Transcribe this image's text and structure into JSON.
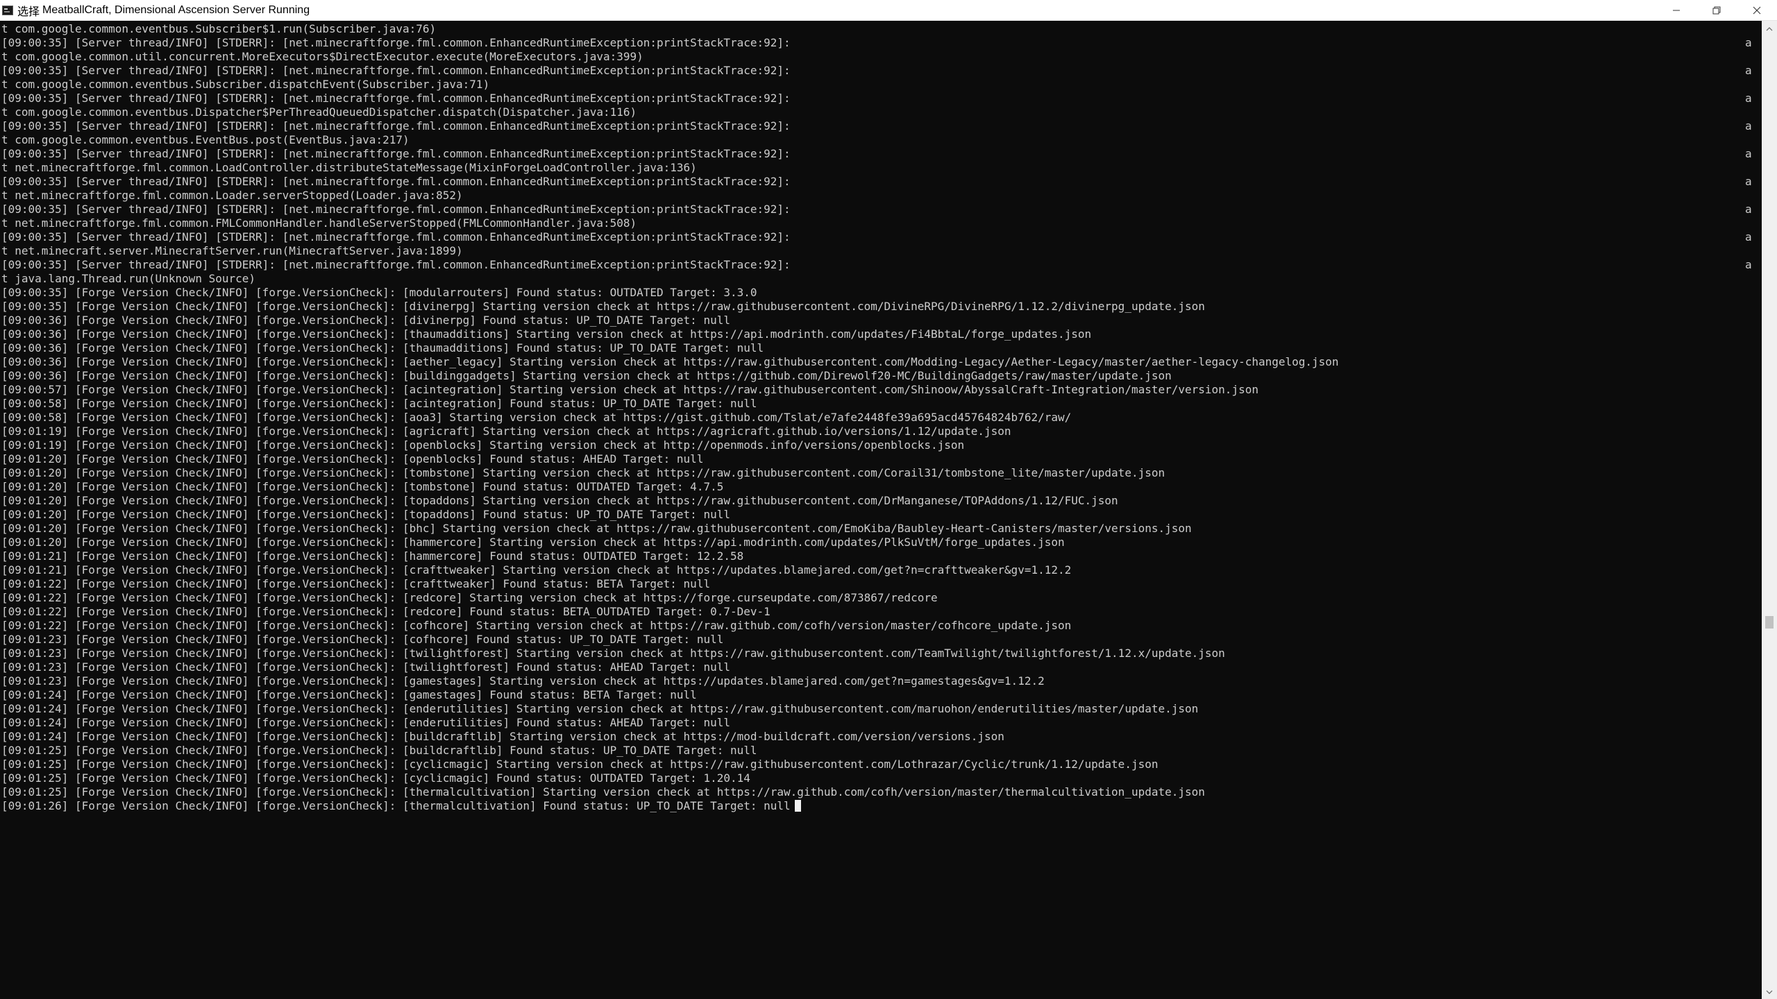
{
  "window": {
    "title_prefix": "选择",
    "title": "MeatballCraft, Dimensional Ascension Server Running"
  },
  "controls": {
    "minimize": "minimize-icon",
    "maximize": "restore-icon",
    "close": "close-icon"
  },
  "console": {
    "lines": [
      "t com.google.common.eventbus.Subscriber$1.run(Subscriber.java:76)",
      "[09:00:35] [Server thread/INFO] [STDERR]: [net.minecraftforge.fml.common.EnhancedRuntimeException:printStackTrace:92]:",
      "t com.google.common.util.concurrent.MoreExecutors$DirectExecutor.execute(MoreExecutors.java:399)",
      "[09:00:35] [Server thread/INFO] [STDERR]: [net.minecraftforge.fml.common.EnhancedRuntimeException:printStackTrace:92]:",
      "t com.google.common.eventbus.Subscriber.dispatchEvent(Subscriber.java:71)",
      "[09:00:35] [Server thread/INFO] [STDERR]: [net.minecraftforge.fml.common.EnhancedRuntimeException:printStackTrace:92]:",
      "t com.google.common.eventbus.Dispatcher$PerThreadQueuedDispatcher.dispatch(Dispatcher.java:116)",
      "[09:00:35] [Server thread/INFO] [STDERR]: [net.minecraftforge.fml.common.EnhancedRuntimeException:printStackTrace:92]:",
      "t com.google.common.eventbus.EventBus.post(EventBus.java:217)",
      "[09:00:35] [Server thread/INFO] [STDERR]: [net.minecraftforge.fml.common.EnhancedRuntimeException:printStackTrace:92]:",
      "t net.minecraftforge.fml.common.LoadController.distributeStateMessage(MixinForgeLoadController.java:136)",
      "[09:00:35] [Server thread/INFO] [STDERR]: [net.minecraftforge.fml.common.EnhancedRuntimeException:printStackTrace:92]:",
      "t net.minecraftforge.fml.common.Loader.serverStopped(Loader.java:852)",
      "[09:00:35] [Server thread/INFO] [STDERR]: [net.minecraftforge.fml.common.EnhancedRuntimeException:printStackTrace:92]:",
      "t net.minecraftforge.fml.common.FMLCommonHandler.handleServerStopped(FMLCommonHandler.java:508)",
      "[09:00:35] [Server thread/INFO] [STDERR]: [net.minecraftforge.fml.common.EnhancedRuntimeException:printStackTrace:92]:",
      "t net.minecraft.server.MinecraftServer.run(MinecraftServer.java:1899)",
      "[09:00:35] [Server thread/INFO] [STDERR]: [net.minecraftforge.fml.common.EnhancedRuntimeException:printStackTrace:92]:",
      "t java.lang.Thread.run(Unknown Source)",
      "[09:00:35] [Forge Version Check/INFO] [forge.VersionCheck]: [modularrouters] Found status: OUTDATED Target: 3.3.0",
      "[09:00:35] [Forge Version Check/INFO] [forge.VersionCheck]: [divinerpg] Starting version check at https://raw.githubusercontent.com/DivineRPG/DivineRPG/1.12.2/divinerpg_update.json",
      "[09:00:36] [Forge Version Check/INFO] [forge.VersionCheck]: [divinerpg] Found status: UP_TO_DATE Target: null",
      "[09:00:36] [Forge Version Check/INFO] [forge.VersionCheck]: [thaumadditions] Starting version check at https://api.modrinth.com/updates/Fi4BbtaL/forge_updates.json",
      "[09:00:36] [Forge Version Check/INFO] [forge.VersionCheck]: [thaumadditions] Found status: UP_TO_DATE Target: null",
      "[09:00:36] [Forge Version Check/INFO] [forge.VersionCheck]: [aether_legacy] Starting version check at https://raw.githubusercontent.com/Modding-Legacy/Aether-Legacy/master/aether-legacy-changelog.json",
      "[09:00:36] [Forge Version Check/INFO] [forge.VersionCheck]: [buildinggadgets] Starting version check at https://github.com/Direwolf20-MC/BuildingGadgets/raw/master/update.json",
      "[09:00:57] [Forge Version Check/INFO] [forge.VersionCheck]: [acintegration] Starting version check at https://raw.githubusercontent.com/Shinoow/AbyssalCraft-Integration/master/version.json",
      "[09:00:58] [Forge Version Check/INFO] [forge.VersionCheck]: [acintegration] Found status: UP_TO_DATE Target: null",
      "[09:00:58] [Forge Version Check/INFO] [forge.VersionCheck]: [aoa3] Starting version check at https://gist.github.com/Tslat/e7afe2448fe39a695acd45764824b762/raw/",
      "[09:01:19] [Forge Version Check/INFO] [forge.VersionCheck]: [agricraft] Starting version check at https://agricraft.github.io/versions/1.12/update.json",
      "[09:01:19] [Forge Version Check/INFO] [forge.VersionCheck]: [openblocks] Starting version check at http://openmods.info/versions/openblocks.json",
      "[09:01:20] [Forge Version Check/INFO] [forge.VersionCheck]: [openblocks] Found status: AHEAD Target: null",
      "[09:01:20] [Forge Version Check/INFO] [forge.VersionCheck]: [tombstone] Starting version check at https://raw.githubusercontent.com/Corail31/tombstone_lite/master/update.json",
      "[09:01:20] [Forge Version Check/INFO] [forge.VersionCheck]: [tombstone] Found status: OUTDATED Target: 4.7.5",
      "[09:01:20] [Forge Version Check/INFO] [forge.VersionCheck]: [topaddons] Starting version check at https://raw.githubusercontent.com/DrManganese/TOPAddons/1.12/FUC.json",
      "[09:01:20] [Forge Version Check/INFO] [forge.VersionCheck]: [topaddons] Found status: UP_TO_DATE Target: null",
      "[09:01:20] [Forge Version Check/INFO] [forge.VersionCheck]: [bhc] Starting version check at https://raw.githubusercontent.com/EmoKiba/Baubley-Heart-Canisters/master/versions.json",
      "[09:01:20] [Forge Version Check/INFO] [forge.VersionCheck]: [hammercore] Starting version check at https://api.modrinth.com/updates/PlkSuVtM/forge_updates.json",
      "[09:01:21] [Forge Version Check/INFO] [forge.VersionCheck]: [hammercore] Found status: OUTDATED Target: 12.2.58",
      "[09:01:21] [Forge Version Check/INFO] [forge.VersionCheck]: [crafttweaker] Starting version check at https://updates.blamejared.com/get?n=crafttweaker&gv=1.12.2",
      "[09:01:22] [Forge Version Check/INFO] [forge.VersionCheck]: [crafttweaker] Found status: BETA Target: null",
      "[09:01:22] [Forge Version Check/INFO] [forge.VersionCheck]: [redcore] Starting version check at https://forge.curseupdate.com/873867/redcore",
      "[09:01:22] [Forge Version Check/INFO] [forge.VersionCheck]: [redcore] Found status: BETA_OUTDATED Target: 0.7-Dev-1",
      "[09:01:22] [Forge Version Check/INFO] [forge.VersionCheck]: [cofhcore] Starting version check at https://raw.github.com/cofh/version/master/cofhcore_update.json",
      "[09:01:23] [Forge Version Check/INFO] [forge.VersionCheck]: [cofhcore] Found status: UP_TO_DATE Target: null",
      "[09:01:23] [Forge Version Check/INFO] [forge.VersionCheck]: [twilightforest] Starting version check at https://raw.githubusercontent.com/TeamTwilight/twilightforest/1.12.x/update.json",
      "[09:01:23] [Forge Version Check/INFO] [forge.VersionCheck]: [twilightforest] Found status: AHEAD Target: null",
      "[09:01:23] [Forge Version Check/INFO] [forge.VersionCheck]: [gamestages] Starting version check at https://updates.blamejared.com/get?n=gamestages&gv=1.12.2",
      "[09:01:24] [Forge Version Check/INFO] [forge.VersionCheck]: [gamestages] Found status: BETA Target: null",
      "[09:01:24] [Forge Version Check/INFO] [forge.VersionCheck]: [enderutilities] Starting version check at https://raw.githubusercontent.com/maruohon/enderutilities/master/update.json",
      "[09:01:24] [Forge Version Check/INFO] [forge.VersionCheck]: [enderutilities] Found status: AHEAD Target: null",
      "[09:01:24] [Forge Version Check/INFO] [forge.VersionCheck]: [buildcraftlib] Starting version check at https://mod-buildcraft.com/version/versions.json",
      "[09:01:25] [Forge Version Check/INFO] [forge.VersionCheck]: [buildcraftlib] Found status: UP_TO_DATE Target: null",
      "[09:01:25] [Forge Version Check/INFO] [forge.VersionCheck]: [cyclicmagic] Starting version check at https://raw.githubusercontent.com/Lothrazar/Cyclic/trunk/1.12/update.json",
      "[09:01:25] [Forge Version Check/INFO] [forge.VersionCheck]: [cyclicmagic] Found status: OUTDATED Target: 1.20.14",
      "[09:01:25] [Forge Version Check/INFO] [forge.VersionCheck]: [thermalcultivation] Starting version check at https://raw.github.com/cofh/version/master/thermalcultivation_update.json",
      "[09:01:26] [Forge Version Check/INFO] [forge.VersionCheck]: [thermalcultivation] Found status: UP_TO_DATE Target: null"
    ],
    "wrap_char": "a",
    "wrap_rows": [
      1,
      3,
      5,
      7,
      9,
      11,
      13,
      15,
      17
    ]
  },
  "colors": {
    "background": "#0c0c0c",
    "text": "#cccccc",
    "titlebar": "#ffffff"
  }
}
